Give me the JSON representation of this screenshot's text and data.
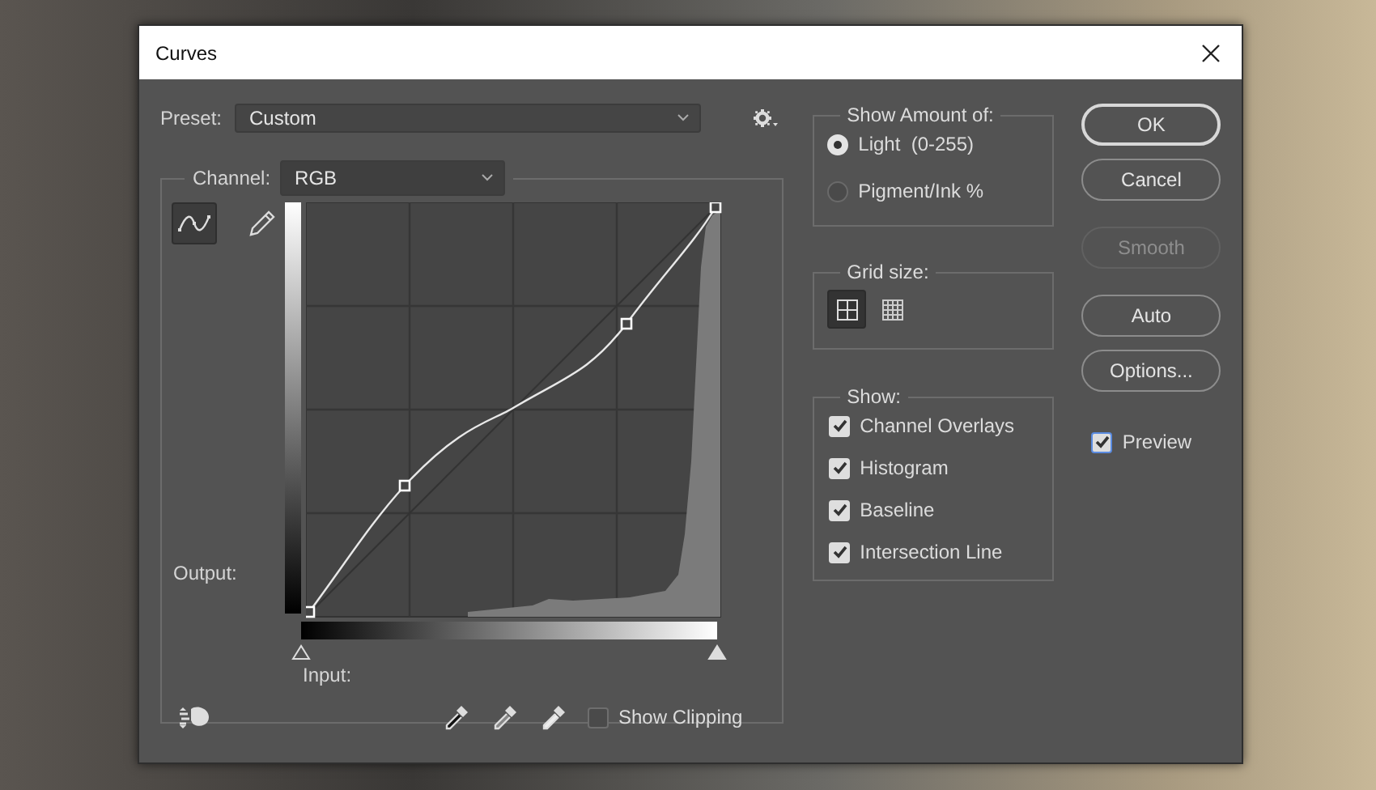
{
  "window": {
    "title": "Curves"
  },
  "preset": {
    "label": "Preset:",
    "value": "Custom"
  },
  "channel": {
    "label": "Channel:",
    "value": "RGB"
  },
  "tools": [
    {
      "kind": "curve",
      "selected": true
    },
    {
      "kind": "pencil",
      "selected": false
    }
  ],
  "graph": {
    "output_label": "Output:",
    "input_label": "Input:"
  },
  "input_sliders": [
    {
      "kind": "black_point",
      "level": 0
    },
    {
      "kind": "white_point",
      "level": 1
    }
  ],
  "show_clipping": {
    "label": "Show Clipping",
    "checked": false
  },
  "show_amount": {
    "title": "Show Amount of:",
    "options": [
      {
        "label": "Light  (0-255)",
        "selected": true
      },
      {
        "label": "Pigment/Ink %",
        "selected": false
      }
    ]
  },
  "grid_size": {
    "title": "Grid size:",
    "options": [
      {
        "kind": "quarters",
        "selected": true
      },
      {
        "kind": "tenths",
        "selected": false
      }
    ]
  },
  "show": {
    "title": "Show:",
    "options": [
      {
        "label": "Channel Overlays",
        "checked": true
      },
      {
        "label": "Histogram",
        "checked": true
      },
      {
        "label": "Baseline",
        "checked": true
      },
      {
        "label": "Intersection Line",
        "checked": true
      }
    ]
  },
  "buttons": [
    {
      "label": "OK",
      "kind": "default",
      "disabled": false
    },
    {
      "label": "Cancel",
      "kind": "normal",
      "disabled": false
    },
    {
      "label": "Smooth",
      "kind": "normal",
      "disabled": true
    },
    {
      "label": "Auto",
      "kind": "normal",
      "disabled": false
    },
    {
      "label": "Options...",
      "kind": "normal",
      "disabled": false
    }
  ],
  "preview": {
    "label": "Preview",
    "checked": true
  }
}
